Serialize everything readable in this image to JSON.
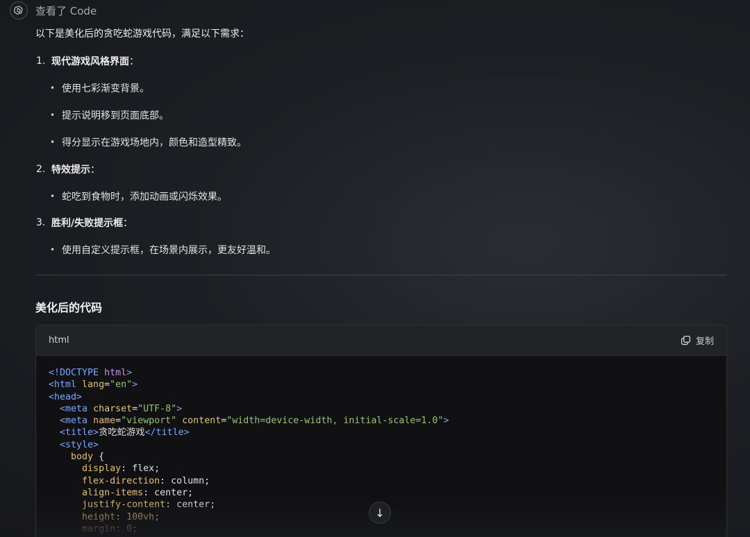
{
  "header": {
    "avatar_icon": "openai-logo-icon",
    "status_text": "查看了 Code"
  },
  "message": {
    "intro": "以下是美化后的贪吃蛇游戏代码，满足以下需求：",
    "items": [
      {
        "number": "1.",
        "label": "现代游戏风格界面",
        "colon": "：",
        "subitems": [
          "使用七彩渐变背景。",
          "提示说明移到页面底部。",
          "得分显示在游戏场地内，颜色和造型精致。"
        ]
      },
      {
        "number": "2.",
        "label": "特效提示",
        "colon": "：",
        "subitems": [
          "蛇吃到食物时，添加动画或闪烁效果。"
        ]
      },
      {
        "number": "3.",
        "label": "胜利/失败提示框",
        "colon": "：",
        "subitems": [
          "使用自定义提示框，在场景内展示，更友好温和。"
        ]
      }
    ],
    "section_title": "美化后的代码"
  },
  "code_block": {
    "language": "html",
    "copy_label": "复制",
    "copy_icon": "copy-icon",
    "lines": [
      [
        [
          "tag",
          "<!DOCTYPE "
        ],
        [
          "kw",
          "html"
        ],
        [
          "tag",
          ">"
        ]
      ],
      [
        [
          "tag",
          "<html "
        ],
        [
          "attr",
          "lang"
        ],
        [
          "txt",
          "="
        ],
        [
          "str",
          "\"en\""
        ],
        [
          "tag",
          ">"
        ]
      ],
      [
        [
          "tag",
          "<head>"
        ]
      ],
      [
        [
          "txt",
          "  "
        ],
        [
          "tag",
          "<meta "
        ],
        [
          "attr",
          "charset"
        ],
        [
          "txt",
          "="
        ],
        [
          "str",
          "\"UTF-8\""
        ],
        [
          "tag",
          ">"
        ]
      ],
      [
        [
          "txt",
          "  "
        ],
        [
          "tag",
          "<meta "
        ],
        [
          "attr",
          "name"
        ],
        [
          "txt",
          "="
        ],
        [
          "str",
          "\"viewport\" "
        ],
        [
          "attr",
          "content"
        ],
        [
          "txt",
          "="
        ],
        [
          "str",
          "\"width=device-width, initial-scale=1.0\""
        ],
        [
          "tag",
          ">"
        ]
      ],
      [
        [
          "txt",
          "  "
        ],
        [
          "tag",
          "<title>"
        ],
        [
          "txt",
          "贪吃蛇游戏"
        ],
        [
          "tag",
          "</title>"
        ]
      ],
      [
        [
          "txt",
          "  "
        ],
        [
          "tag",
          "<style>"
        ]
      ],
      [
        [
          "txt",
          "    "
        ],
        [
          "sel",
          "body"
        ],
        [
          "txt",
          " {"
        ]
      ],
      [
        [
          "txt",
          "      "
        ],
        [
          "prop",
          "display"
        ],
        [
          "txt",
          ": flex;"
        ]
      ],
      [
        [
          "txt",
          "      "
        ],
        [
          "prop",
          "flex-direction"
        ],
        [
          "txt",
          ": column;"
        ]
      ],
      [
        [
          "txt",
          "      "
        ],
        [
          "prop",
          "align-items"
        ],
        [
          "txt",
          ": center;"
        ]
      ],
      [
        [
          "txt",
          "      "
        ],
        [
          "prop",
          "justify-content"
        ],
        [
          "txt",
          ": center;"
        ]
      ],
      [
        [
          "txt",
          "      "
        ],
        [
          "prop",
          "height"
        ],
        [
          "txt",
          ": "
        ],
        [
          "num",
          "100vh"
        ],
        [
          "txt",
          ";"
        ]
      ],
      [
        [
          "txt",
          "      "
        ],
        [
          "prop",
          "margin"
        ],
        [
          "txt",
          ": "
        ],
        [
          "num",
          "0"
        ],
        [
          "txt",
          ";"
        ]
      ]
    ]
  },
  "scroll_button": {
    "icon": "arrow-down-icon",
    "glyph": "↓"
  }
}
